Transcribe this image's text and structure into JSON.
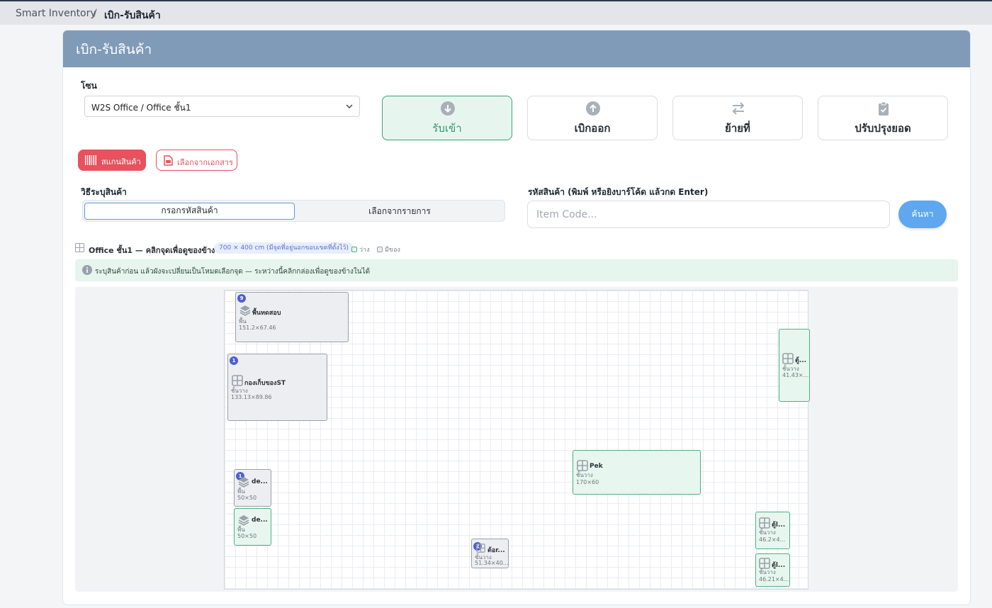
{
  "breadcrumb": {
    "root": "Smart Inventory",
    "separator": "/",
    "current": "เบิก-รับสินค้า"
  },
  "page": {
    "title": "เบิก-รับสินค้า"
  },
  "zone": {
    "label": "โซน",
    "selected": "W2S Office / Office ชั้น1"
  },
  "modes": [
    {
      "label": "รับเข้า",
      "icon": "arrow-down-circle-icon",
      "active": true
    },
    {
      "label": "เบิกออก",
      "icon": "arrow-up-circle-icon",
      "active": false
    },
    {
      "label": "ย้ายที่",
      "icon": "swap-arrows-icon",
      "active": false
    },
    {
      "label": "ปรับปรุงยอด",
      "icon": "clipboard-check-icon",
      "active": false
    }
  ],
  "actions": {
    "scan_label": "สแกนสินค้า",
    "doc_label": "เลือกจากเอกสาร"
  },
  "method": {
    "label": "วิธีระบุสินค้า",
    "option_code": "กรอกรหัสสินค้า",
    "option_list": "เลือกจากรายการ"
  },
  "code": {
    "label": "รหัสสินค้า (พิมพ์ หรือยิงบาร์โค้ด แล้วกด Enter)",
    "placeholder": "Item Code...",
    "value": "",
    "search_label": "ค้นหา"
  },
  "map": {
    "title": "Office ชั้น1 — คลิกจุดเพื่อดูของข้างใน",
    "size_chip": "700 × 400 cm (มีจุดที่อยู่นอกขอบเขตที่ตั้งไว้)",
    "legend_empty": "ว่าง",
    "legend_used": "มีของ",
    "notice": "ระบุสินค้าก่อน แล้วผังจะเปลี่ยนเป็นโหมดเลือกจุด — ระหว่างนี้คลิกกล่องเพื่อดูของข้างในได้",
    "colors": {
      "empty": "#e7f6ee",
      "used": "#eceef1",
      "badge": "#4f5fd1"
    }
  },
  "slots": [
    {
      "name": "พื้นทดสอบ",
      "type": "พื้น",
      "dims": "151.2×67.46",
      "badge": "9",
      "icon": "layers-icon",
      "state": "used"
    },
    {
      "name": "กองเก็บของST",
      "type": "ชั้นวาง",
      "dims": "133.13×89.86",
      "badge": "1",
      "icon": "shelf-grid-icon",
      "state": "used"
    },
    {
      "name": "ตู้...",
      "type": "ชั้นวาง",
      "dims": "41.43×...",
      "badge": "",
      "icon": "shelf-grid-icon",
      "state": "empty"
    },
    {
      "name": "Pek",
      "type": "ชั้นวาง",
      "dims": "170×60",
      "badge": "",
      "icon": "shelf-grid-icon",
      "state": "empty"
    },
    {
      "name": "de...",
      "type": "พื้น",
      "dims": "50×50",
      "badge": "1",
      "icon": "layers-icon",
      "state": "used"
    },
    {
      "name": "de...",
      "type": "พื้น",
      "dims": "50×50",
      "badge": "",
      "icon": "layers-icon",
      "state": "empty"
    },
    {
      "name": "ต้อr...",
      "type": "ชั้นวาง",
      "dims": "51.34×40...",
      "badge": "2",
      "icon": "shelf-grid-icon",
      "state": "used"
    },
    {
      "name": "ตู้l...",
      "type": "ชั้นวาง",
      "dims": "46.2×4...",
      "badge": "",
      "icon": "shelf-grid-icon",
      "state": "empty"
    },
    {
      "name": "ตู้l...",
      "type": "ชั้นวาง",
      "dims": "46.21×4...",
      "badge": "",
      "icon": "shelf-grid-icon",
      "state": "empty"
    }
  ]
}
